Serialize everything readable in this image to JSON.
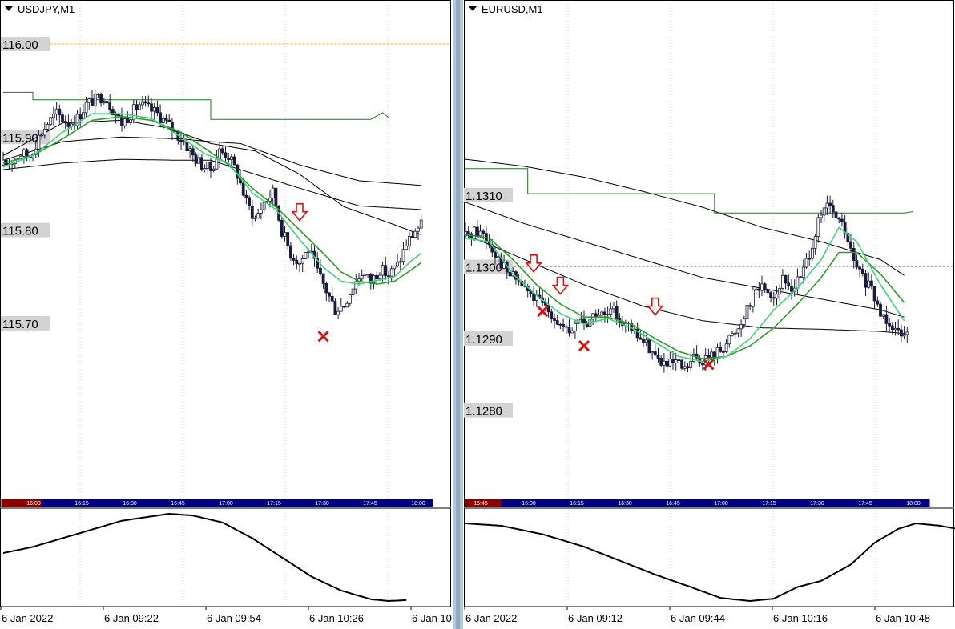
{
  "colors": {
    "background": "#ffffff",
    "grid": "#c8c8c8",
    "candle": "#1a1a3a",
    "ema_fast": "#3bd67a",
    "ema_slow": "#2aa02a",
    "envelope": "#000000",
    "step_line": "#1e7a1e",
    "level": "#f0b400",
    "arrow": "#e01010",
    "price_label_bg": "#d3d3d3",
    "session_bar": "#000080",
    "session_past": "#8b0000"
  },
  "icons": [
    "dropdown-triangle-icon",
    "sell-arrow-icon",
    "exit-cross-icon"
  ],
  "chart_data": [
    {
      "type": "candlestick",
      "symbol": "USDJPY,M1",
      "title": "USDJPY,M1",
      "ylim": [
        115.632,
        116.018
      ],
      "price_labels": [
        "116.00",
        "115.90",
        "115.80",
        "115.70"
      ],
      "level_line": 116.0,
      "x_labels": [
        "6 Jan 2022",
        "6 Jan 09:22",
        "6 Jan 09:54",
        "6 Jan 10:26",
        "6 Jan 10"
      ],
      "session_labels": [
        "16:00",
        "16:15",
        "16:30",
        "16:45",
        "17:00",
        "17:15",
        "17:30",
        "17:45",
        "18:00"
      ],
      "anchors": [
        [
          0,
          115.87
        ],
        [
          3,
          115.875
        ],
        [
          6,
          115.882
        ],
        [
          9,
          115.88
        ],
        [
          12,
          115.9
        ],
        [
          15,
          115.915
        ],
        [
          18,
          115.925
        ],
        [
          22,
          115.915
        ],
        [
          25,
          115.92
        ],
        [
          28,
          115.935
        ],
        [
          31,
          115.94
        ],
        [
          34,
          115.945
        ],
        [
          37,
          115.93
        ],
        [
          40,
          115.915
        ],
        [
          43,
          115.925
        ],
        [
          46,
          115.935
        ],
        [
          49,
          115.93
        ],
        [
          52,
          115.925
        ],
        [
          55,
          115.915
        ],
        [
          58,
          115.905
        ],
        [
          61,
          115.895
        ],
        [
          64,
          115.88
        ],
        [
          67,
          115.87
        ],
        [
          70,
          115.865
        ],
        [
          73,
          115.885
        ],
        [
          76,
          115.88
        ],
        [
          79,
          115.86
        ],
        [
          82,
          115.83
        ],
        [
          85,
          115.812
        ],
        [
          88,
          115.83
        ],
        [
          91,
          115.84
        ],
        [
          94,
          115.8
        ],
        [
          97,
          115.775
        ],
        [
          100,
          115.765
        ],
        [
          103,
          115.78
        ],
        [
          106,
          115.755
        ],
        [
          109,
          115.735
        ],
        [
          112,
          115.715
        ],
        [
          115,
          115.72
        ],
        [
          118,
          115.74
        ],
        [
          121,
          115.755
        ],
        [
          124,
          115.745
        ],
        [
          127,
          115.758
        ],
        [
          130,
          115.752
        ],
        [
          133,
          115.762
        ],
        [
          136,
          115.785
        ],
        [
          139,
          115.8
        ],
        [
          141,
          115.805
        ]
      ],
      "ema_fast": [
        [
          0,
          115.868
        ],
        [
          10,
          115.88
        ],
        [
          20,
          115.905
        ],
        [
          30,
          115.925
        ],
        [
          40,
          115.925
        ],
        [
          50,
          115.92
        ],
        [
          60,
          115.9
        ],
        [
          68,
          115.882
        ],
        [
          76,
          115.872
        ],
        [
          84,
          115.84
        ],
        [
          92,
          115.822
        ],
        [
          100,
          115.79
        ],
        [
          108,
          115.76
        ],
        [
          114,
          115.745
        ],
        [
          120,
          115.742
        ],
        [
          126,
          115.746
        ],
        [
          132,
          115.75
        ],
        [
          138,
          115.768
        ],
        [
          141,
          115.775
        ]
      ],
      "ema_slow": [
        [
          0,
          115.872
        ],
        [
          10,
          115.88
        ],
        [
          20,
          115.898
        ],
        [
          30,
          115.918
        ],
        [
          40,
          115.922
        ],
        [
          50,
          115.918
        ],
        [
          60,
          115.905
        ],
        [
          68,
          115.888
        ],
        [
          76,
          115.87
        ],
        [
          84,
          115.845
        ],
        [
          92,
          115.825
        ],
        [
          100,
          115.8
        ],
        [
          108,
          115.775
        ],
        [
          114,
          115.755
        ],
        [
          120,
          115.745
        ],
        [
          126,
          115.742
        ],
        [
          132,
          115.745
        ],
        [
          138,
          115.758
        ],
        [
          141,
          115.765
        ]
      ],
      "envelope": [
        [
          [
            0,
            115.875
          ],
          [
            20,
            115.895
          ],
          [
            40,
            115.9
          ],
          [
            60,
            115.898
          ],
          [
            70,
            115.895
          ],
          [
            80,
            115.893
          ],
          [
            100,
            115.87
          ],
          [
            120,
            115.853
          ],
          [
            141,
            115.848
          ]
        ],
        [
          [
            0,
            115.88
          ],
          [
            20,
            115.915
          ],
          [
            40,
            115.918
          ],
          [
            55,
            115.91
          ],
          [
            70,
            115.893
          ],
          [
            85,
            115.885
          ],
          [
            100,
            115.86
          ],
          [
            115,
            115.825
          ],
          [
            130,
            115.808
          ],
          [
            141,
            115.795
          ]
        ],
        [
          [
            0,
            115.865
          ],
          [
            20,
            115.872
          ],
          [
            40,
            115.876
          ],
          [
            60,
            115.875
          ],
          [
            70,
            115.875
          ],
          [
            85,
            115.86
          ],
          [
            100,
            115.845
          ],
          [
            120,
            115.826
          ],
          [
            141,
            115.822
          ]
        ]
      ],
      "step_line": [
        [
          0,
          115.948
        ],
        [
          10,
          115.948
        ],
        [
          10,
          115.94
        ],
        [
          70,
          115.94
        ],
        [
          70,
          115.919
        ],
        [
          124,
          115.919
        ],
        [
          128,
          115.926
        ],
        [
          130,
          115.921
        ]
      ],
      "sell_arrows": [
        [
          100,
          115.818
        ]
      ],
      "exit_marks": [
        [
          108,
          115.686
        ]
      ],
      "oscillator": [
        [
          0,
          0.55
        ],
        [
          10,
          0.62
        ],
        [
          20,
          0.72
        ],
        [
          30,
          0.82
        ],
        [
          40,
          0.92
        ],
        [
          50,
          0.97
        ],
        [
          56,
          1.0
        ],
        [
          64,
          0.98
        ],
        [
          74,
          0.9
        ],
        [
          84,
          0.72
        ],
        [
          94,
          0.5
        ],
        [
          104,
          0.28
        ],
        [
          114,
          0.12
        ],
        [
          124,
          0.02
        ],
        [
          130,
          0.0
        ],
        [
          136,
          0.01
        ]
      ]
    },
    {
      "type": "candlestick",
      "symbol": "EURUSD,M1",
      "title": "EURUSD,M1",
      "ylim": [
        1.12736,
        1.13236
      ],
      "price_labels": [
        "1.1310",
        "1.1300",
        "1.1290",
        "1.1280"
      ],
      "level_line": 1.13,
      "x_labels": [
        "6 Jan 2022",
        "6 Jan 09:12",
        "6 Jan 09:44",
        "6 Jan 10:16",
        "6 Jan 10:48"
      ],
      "session_labels": [
        "15:45",
        "16:00",
        "16:15",
        "16:30",
        "16:45",
        "17:00",
        "17:15",
        "17:30",
        "17:45",
        "18:00"
      ],
      "anchors": [
        [
          0,
          1.13043
        ],
        [
          3,
          1.1305
        ],
        [
          6,
          1.13047
        ],
        [
          10,
          1.1302
        ],
        [
          14,
          1.12992
        ],
        [
          18,
          1.1298
        ],
        [
          22,
          1.1296
        ],
        [
          26,
          1.12947
        ],
        [
          29,
          1.12937
        ],
        [
          32,
          1.12918
        ],
        [
          35,
          1.12905
        ],
        [
          38,
          1.12928
        ],
        [
          41,
          1.12922
        ],
        [
          44,
          1.12935
        ],
        [
          47,
          1.1293
        ],
        [
          50,
          1.12938
        ],
        [
          53,
          1.12925
        ],
        [
          56,
          1.1291
        ],
        [
          59,
          1.129
        ],
        [
          62,
          1.12888
        ],
        [
          65,
          1.1287
        ],
        [
          68,
          1.12862
        ],
        [
          71,
          1.12865
        ],
        [
          74,
          1.12855
        ],
        [
          77,
          1.12872
        ],
        [
          80,
          1.1287
        ],
        [
          83,
          1.12875
        ],
        [
          86,
          1.12885
        ],
        [
          89,
          1.129
        ],
        [
          92,
          1.12915
        ],
        [
          95,
          1.12945
        ],
        [
          98,
          1.1297
        ],
        [
          101,
          1.12972
        ],
        [
          104,
          1.12958
        ],
        [
          107,
          1.1298
        ],
        [
          110,
          1.1297
        ],
        [
          113,
          1.12985
        ],
        [
          116,
          1.1302
        ],
        [
          119,
          1.1306
        ],
        [
          122,
          1.13085
        ],
        [
          125,
          1.1307
        ],
        [
          128,
          1.1305
        ],
        [
          131,
          1.13005
        ],
        [
          134,
          1.12985
        ],
        [
          137,
          1.12965
        ],
        [
          140,
          1.12935
        ],
        [
          143,
          1.12925
        ],
        [
          146,
          1.1291
        ],
        [
          149,
          1.12915
        ]
      ],
      "ema_fast": [
        [
          0,
          1.1304
        ],
        [
          8,
          1.13035
        ],
        [
          16,
          1.1299
        ],
        [
          24,
          1.1296
        ],
        [
          32,
          1.12935
        ],
        [
          40,
          1.1292
        ],
        [
          48,
          1.12928
        ],
        [
          56,
          1.12915
        ],
        [
          64,
          1.12895
        ],
        [
          72,
          1.12875
        ],
        [
          80,
          1.12868
        ],
        [
          88,
          1.12875
        ],
        [
          96,
          1.129
        ],
        [
          104,
          1.1294
        ],
        [
          112,
          1.1297
        ],
        [
          120,
          1.1301
        ],
        [
          126,
          1.13055
        ],
        [
          132,
          1.13035
        ],
        [
          140,
          1.12975
        ],
        [
          148,
          1.12925
        ]
      ],
      "ema_slow": [
        [
          0,
          1.13045
        ],
        [
          8,
          1.1304
        ],
        [
          16,
          1.1301
        ],
        [
          24,
          1.12975
        ],
        [
          32,
          1.12948
        ],
        [
          40,
          1.1293
        ],
        [
          48,
          1.1293
        ],
        [
          56,
          1.1292
        ],
        [
          64,
          1.129
        ],
        [
          72,
          1.12882
        ],
        [
          80,
          1.12872
        ],
        [
          88,
          1.12875
        ],
        [
          96,
          1.1289
        ],
        [
          104,
          1.12915
        ],
        [
          112,
          1.12948
        ],
        [
          120,
          1.12985
        ],
        [
          126,
          1.1302
        ],
        [
          132,
          1.1302
        ],
        [
          140,
          1.1299
        ],
        [
          148,
          1.1295
        ]
      ],
      "envelope": [
        [
          [
            0,
            1.1315
          ],
          [
            20,
            1.1314
          ],
          [
            40,
            1.13125
          ],
          [
            60,
            1.13105
          ],
          [
            80,
            1.13083
          ],
          [
            100,
            1.13055
          ],
          [
            120,
            1.13035
          ],
          [
            140,
            1.1301
          ],
          [
            148,
            1.12988
          ]
        ],
        [
          [
            0,
            1.1309
          ],
          [
            20,
            1.1306
          ],
          [
            40,
            1.13035
          ],
          [
            60,
            1.1301
          ],
          [
            80,
            1.12985
          ],
          [
            100,
            1.1297
          ],
          [
            120,
            1.12955
          ],
          [
            140,
            1.1294
          ],
          [
            148,
            1.1293
          ]
        ],
        [
          [
            0,
            1.13045
          ],
          [
            20,
            1.1301
          ],
          [
            40,
            1.12975
          ],
          [
            60,
            1.12945
          ],
          [
            80,
            1.12925
          ],
          [
            100,
            1.12915
          ],
          [
            120,
            1.12913
          ],
          [
            140,
            1.1291
          ],
          [
            148,
            1.12907
          ]
        ]
      ],
      "step_line": [
        [
          0,
          1.13137
        ],
        [
          21,
          1.13137
        ],
        [
          21,
          1.13102
        ],
        [
          84,
          1.13102
        ],
        [
          84,
          1.13075
        ],
        [
          148,
          1.13075
        ],
        [
          151,
          1.13077
        ]
      ],
      "sell_arrows": [
        [
          23,
          1.13003
        ],
        [
          32,
          1.12972
        ],
        [
          64,
          1.12943
        ]
      ],
      "exit_marks": [
        [
          26,
          1.12938
        ],
        [
          40,
          1.1289
        ],
        [
          82,
          1.12864
        ]
      ],
      "oscillator": [
        [
          0,
          1.0
        ],
        [
          12,
          0.97
        ],
        [
          26,
          0.86
        ],
        [
          40,
          0.7
        ],
        [
          52,
          0.52
        ],
        [
          64,
          0.34
        ],
        [
          76,
          0.18
        ],
        [
          86,
          0.04
        ],
        [
          96,
          0.0
        ],
        [
          104,
          0.03
        ],
        [
          112,
          0.18
        ],
        [
          120,
          0.26
        ],
        [
          130,
          0.47
        ],
        [
          138,
          0.75
        ],
        [
          146,
          0.93
        ],
        [
          152,
          1.0
        ],
        [
          160,
          0.97
        ],
        [
          170,
          0.9
        ]
      ]
    }
  ]
}
